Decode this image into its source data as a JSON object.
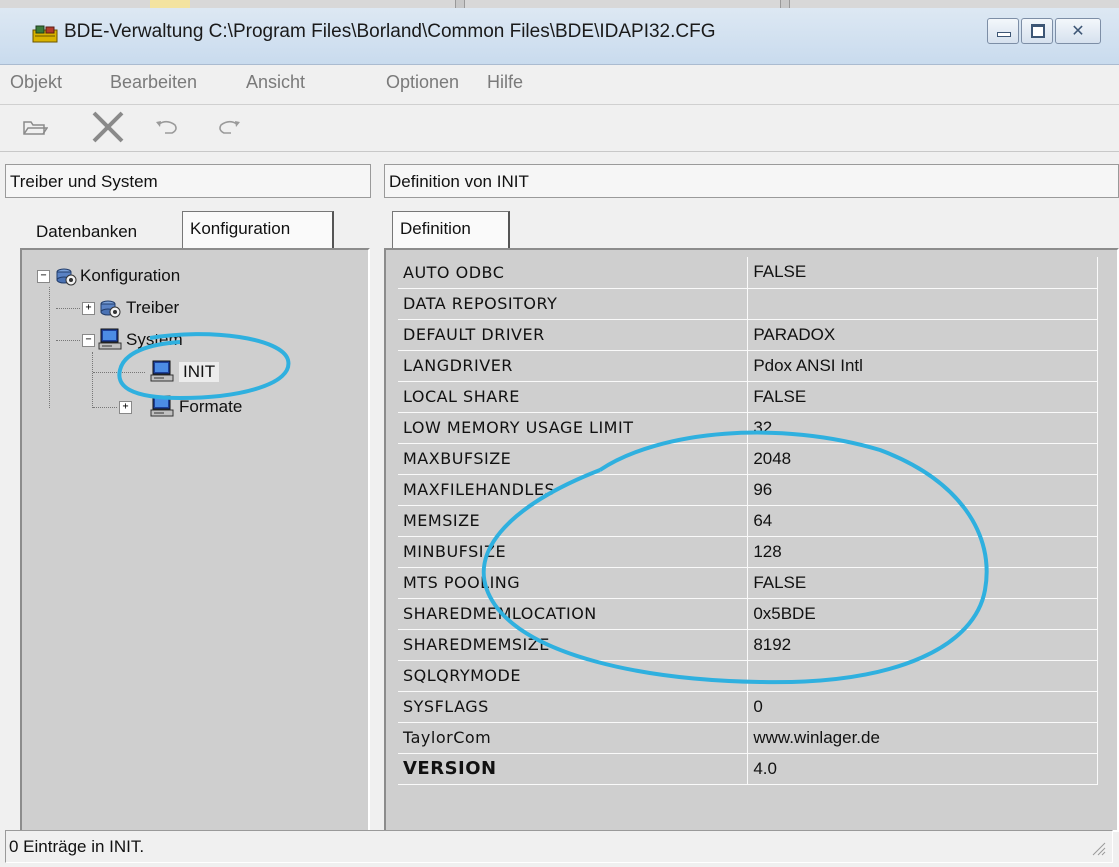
{
  "window": {
    "title": "BDE-Verwaltung  C:\\Program Files\\Borland\\Common Files\\BDE\\IDAPI32.CFG",
    "buttons": {
      "minimize": "minimize-icon",
      "maximize": "maximize-icon",
      "close": "close-icon"
    }
  },
  "menu": {
    "items": [
      "Objekt",
      "Bearbeiten",
      "Ansicht",
      "Optionen",
      "Hilfe"
    ]
  },
  "toolbar": {
    "icons": [
      "open-icon",
      "delete-icon",
      "undo-icon",
      "redo-icon"
    ]
  },
  "left_panel": {
    "header": "Treiber und System",
    "tabs": [
      "Datenbanken",
      "Konfiguration"
    ],
    "active_tab": "Konfiguration",
    "tree": [
      {
        "label": "Konfiguration",
        "level": 0,
        "expander": "-"
      },
      {
        "label": "Treiber",
        "level": 1,
        "expander": "+"
      },
      {
        "label": "System",
        "level": 1,
        "expander": "-"
      },
      {
        "label": "INIT",
        "level": 2,
        "expander": "",
        "selected": true
      },
      {
        "label": "Formate",
        "level": 2,
        "expander": "+"
      }
    ]
  },
  "right_panel": {
    "header": "Definition von INIT",
    "tabs": [
      "Definition"
    ],
    "rows": [
      {
        "name": "AUTO ODBC",
        "value": "FALSE"
      },
      {
        "name": "DATA REPOSITORY",
        "value": ""
      },
      {
        "name": "DEFAULT DRIVER",
        "value": "PARADOX"
      },
      {
        "name": "LANGDRIVER",
        "value": "Pdox ANSI Intl"
      },
      {
        "name": "LOCAL SHARE",
        "value": "FALSE"
      },
      {
        "name": "LOW MEMORY USAGE LIMIT",
        "value": "32"
      },
      {
        "name": "MAXBUFSIZE",
        "value": "2048"
      },
      {
        "name": "MAXFILEHANDLES",
        "value": "96"
      },
      {
        "name": "MEMSIZE",
        "value": "64"
      },
      {
        "name": "MINBUFSIZE",
        "value": "128"
      },
      {
        "name": "MTS POOLING",
        "value": "FALSE"
      },
      {
        "name": "SHAREDMEMLOCATION",
        "value": "0x5BDE"
      },
      {
        "name": "SHAREDMEMSIZE",
        "value": "8192"
      },
      {
        "name": "SQLQRYMODE",
        "value": ""
      },
      {
        "name": "SYSFLAGS",
        "value": "0"
      },
      {
        "name": "TaylorCom",
        "value": "www.winlager.de"
      },
      {
        "name": "VERSION",
        "value": "4.0",
        "bold": true
      }
    ]
  },
  "statusbar": {
    "text": "0 Einträge in INIT."
  },
  "colors": {
    "annotation": "#2fb0df",
    "grid_bg": "#cfcfcf",
    "titlebar": "#c9dbee"
  }
}
